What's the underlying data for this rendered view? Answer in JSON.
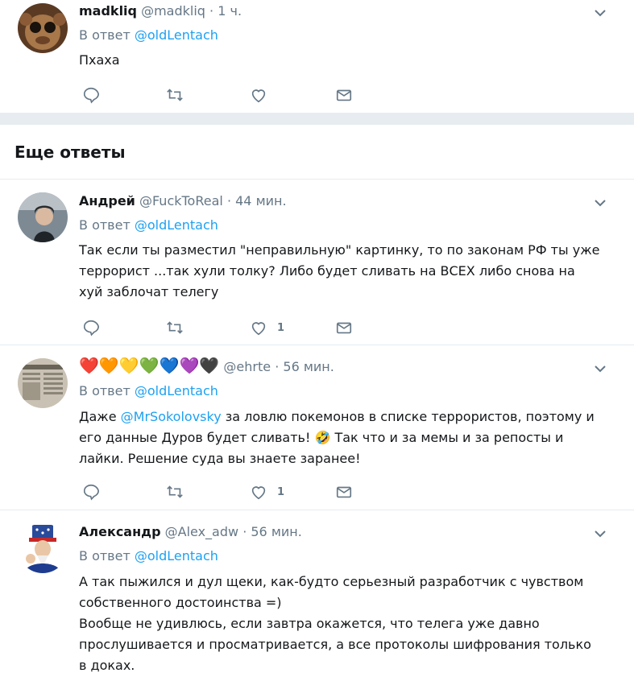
{
  "tweets": [
    {
      "name": "madkliq",
      "handle": "@madkliq",
      "time": "1 ч.",
      "reply_prefix": "В ответ",
      "reply_to": "@oldLentach",
      "text": "Пхаха",
      "like_count": ""
    },
    {
      "name": "Андрей",
      "handle": "@FuckToReal",
      "time": "44 мин.",
      "reply_prefix": "В ответ",
      "reply_to": "@oldLentach",
      "text": "Так если ты разместил \"неправильную\" картинку, то по законам РФ ты уже террорист ...так хули толку? Либо будет сливать на ВСЕХ либо снова на хуй заблочат телегу",
      "like_count": "1"
    },
    {
      "name_emoji": "❤️🧡💛💚💙💜🖤",
      "handle": "@ehrte",
      "time": "56 мин.",
      "reply_prefix": "В ответ",
      "reply_to": "@oldLentach",
      "text_part1": "Даже ",
      "mention": "@MrSokolovsky",
      "text_part2": " за ловлю покемонов в списке террористов, поэтому и его данные Дуров будет сливать! 🤣 Так что и за мемы и за репосты и лайки. Решение суда вы знаете заранее!",
      "like_count": "1"
    },
    {
      "name": "Александр",
      "handle": "@Alex_adw",
      "time": "56 мин.",
      "reply_prefix": "В ответ",
      "reply_to": "@oldLentach",
      "text_line1": "А так пыжился и дул щеки, как-будто серьезный разработчик с чувством собственного достоинства =)",
      "text_line2": "Вообще не удивлюсь, если завтра окажется, что телега уже давно прослушивается и просматривается, а все протоколы шифрования только в доках."
    }
  ],
  "section_title": "Еще ответы",
  "dot": "·",
  "colors": {
    "link": "#1da1f2",
    "muted": "#657786",
    "divider": "#e6ecf0"
  },
  "icons": [
    "reply-icon",
    "retweet-icon",
    "like-icon",
    "message-icon",
    "chevron-down-icon"
  ]
}
